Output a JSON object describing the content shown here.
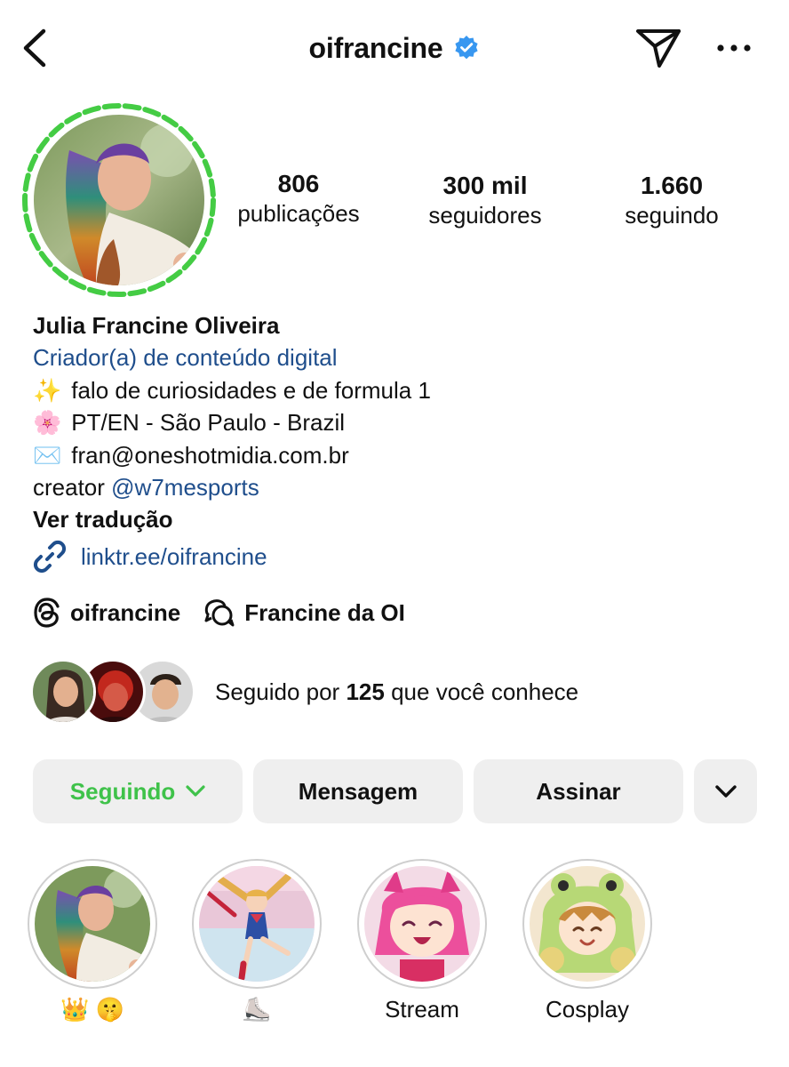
{
  "header": {
    "username": "oifrancine",
    "verified_color": "#3897f0"
  },
  "stats": [
    {
      "value": "806",
      "label": "publicações"
    },
    {
      "value": "300 mil",
      "label": "seguidores"
    },
    {
      "value": "1.660",
      "label": "seguindo"
    }
  ],
  "bio": {
    "name": "Julia Francine Oliveira",
    "category": "Criador(a) de conteúdo digital",
    "lines": [
      {
        "emoji": "✨",
        "text": "falo de curiosidades e de formula 1"
      },
      {
        "emoji": "🌸",
        "text": "PT/EN - São Paulo - Brazil"
      },
      {
        "emoji": "✉️",
        "text": "fran@oneshotmidia.com.br"
      }
    ],
    "creator_prefix": "creator",
    "creator_mention": "@w7mesports",
    "translate": "Ver tradução",
    "link": "linktr.ee/oifrancine"
  },
  "threads": {
    "handle": "oifrancine",
    "channel": "Francine da OI"
  },
  "followed_by": {
    "prefix": "Seguido por",
    "count": "125",
    "suffix": "que você conhece"
  },
  "buttons": {
    "following": "Seguindo",
    "message": "Mensagem",
    "subscribe": "Assinar"
  },
  "highlights": [
    {
      "label": "👑 🤫"
    },
    {
      "label": "⛸️"
    },
    {
      "label": "Stream"
    },
    {
      "label": "Cosplay"
    }
  ],
  "colors": {
    "ring": "#44cc44",
    "link": "#1f4e8c",
    "following": "#3fc24a",
    "button_bg": "#efefef"
  }
}
